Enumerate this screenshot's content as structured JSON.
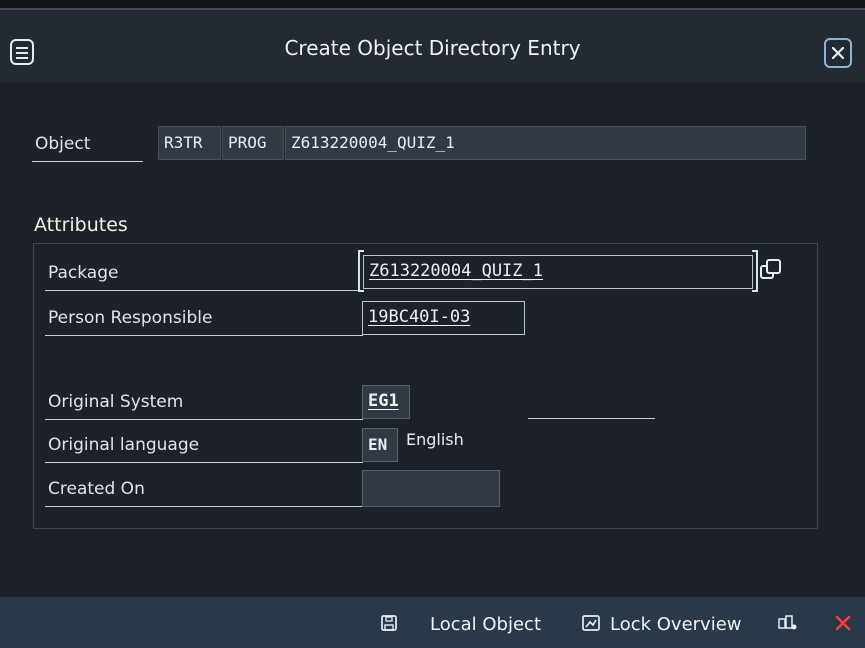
{
  "window": {
    "title": "Create Object Directory Entry"
  },
  "object": {
    "label": "Object",
    "pgmid": "R3TR",
    "type": "PROG",
    "name": "Z613220004_QUIZ_1"
  },
  "attributes": {
    "title": "Attributes",
    "package_label": "Package",
    "package_value": "Z613220004_QUIZ_1",
    "person_label": "Person Responsible",
    "person_value": "19BC40I-03",
    "system_label": "Original System",
    "system_value": "EG1",
    "language_label": "Original language",
    "language_code": "EN",
    "language_name": "English",
    "created_label": "Created On",
    "created_value": ""
  },
  "footer": {
    "local_object": "Local Object",
    "lock_overview": "Lock Overview"
  },
  "icons": {
    "menu": "menu-icon",
    "close": "close-icon",
    "value_help": "value-help-icon",
    "save": "save-icon",
    "lock": "lock-overview-icon",
    "transport": "transport-icon",
    "cancel": "cancel-icon"
  }
}
